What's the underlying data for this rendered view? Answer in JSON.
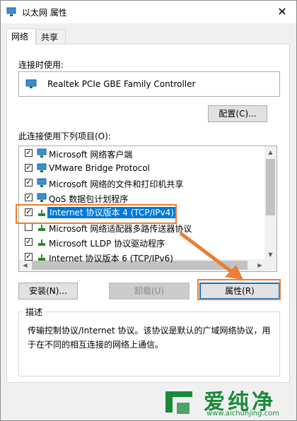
{
  "window": {
    "title": "以太网 属性",
    "close_glyph": "✕"
  },
  "tabs": [
    {
      "label": "网络",
      "active": true
    },
    {
      "label": "共享",
      "active": false
    }
  ],
  "connect_using_label": "连接时使用:",
  "adapter_name": "Realtek PCIe GBE Family Controller",
  "configure_button": "配置(C)...",
  "items_label": "此连接使用下列项目(O):",
  "items": [
    {
      "label": "Microsoft 网络客户端",
      "checked": true,
      "icon": "network-client-icon",
      "selected": false
    },
    {
      "label": "VMware Bridge Protocol",
      "checked": true,
      "icon": "network-client-icon",
      "selected": false
    },
    {
      "label": "Microsoft 网络的文件和打印机共享",
      "checked": true,
      "icon": "network-client-icon",
      "selected": false
    },
    {
      "label": "QoS 数据包计划程序",
      "checked": true,
      "icon": "network-client-icon",
      "selected": false
    },
    {
      "label": "Internet 协议版本 4 (TCP/IPv4)",
      "checked": true,
      "icon": "protocol-icon",
      "selected": true
    },
    {
      "label": "Microsoft 网络适配器多路传送器协议",
      "checked": false,
      "icon": "protocol-icon",
      "selected": false
    },
    {
      "label": "Microsoft LLDP 协议驱动程序",
      "checked": true,
      "icon": "protocol-icon",
      "selected": false
    },
    {
      "label": "Internet 协议版本 6 (TCP/IPv6)",
      "checked": true,
      "icon": "protocol-icon",
      "selected": false
    }
  ],
  "install_button": "安装(N)...",
  "uninstall_button": "卸载(U)",
  "properties_button": "属性(R)",
  "description_label": "描述",
  "description_text": "传输控制协议/Internet 协议。该协议是默认的广域网络协议，用于在不同的相互连接的网络上通信。",
  "watermark": {
    "brand": "爱纯净",
    "url": "www.aichunjing.com"
  },
  "colors": {
    "accent": "#0078d7",
    "highlight": "#ed7d31",
    "watermark": "#1a8a3a"
  }
}
